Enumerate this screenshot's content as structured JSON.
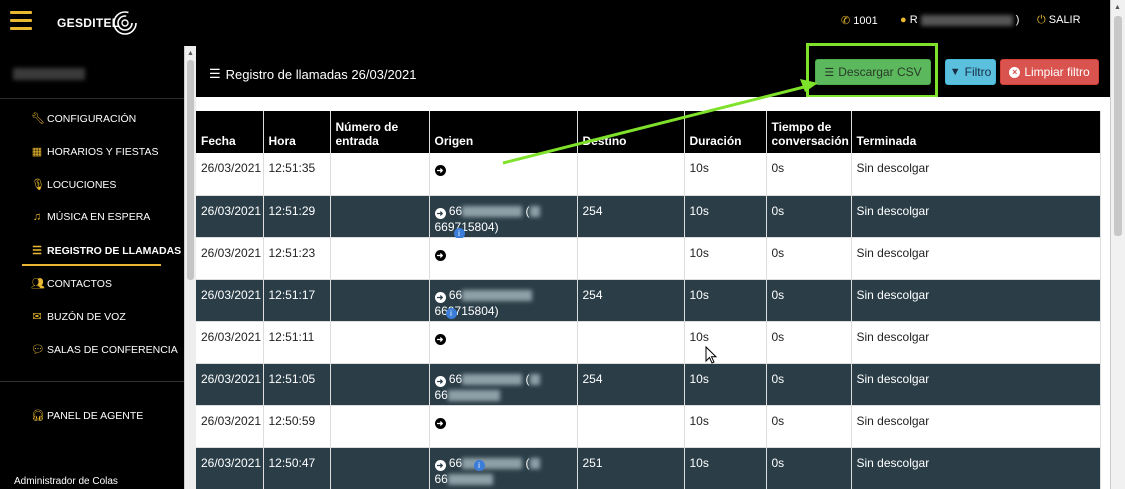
{
  "topbar": {
    "brand": "GESDITEL",
    "extension": "1001",
    "user_visible": "R",
    "user_suffix": ")",
    "logout": "SALIR"
  },
  "sidebar": {
    "items": [
      {
        "label": "CONFIGURACIÓN",
        "icon": "wrench-icon"
      },
      {
        "label": "HORARIOS Y FIESTAS",
        "icon": "calendar-icon"
      },
      {
        "label": "LOCUCIONES",
        "icon": "microphone-icon"
      },
      {
        "label": "MÚSICA EN ESPERA",
        "icon": "music-icon"
      },
      {
        "label": "REGISTRO DE LLAMADAS",
        "icon": "list-icon",
        "active": true
      },
      {
        "label": "CONTACTOS",
        "icon": "users-icon"
      },
      {
        "label": "BUZÓN DE VOZ",
        "icon": "envelope-icon"
      },
      {
        "label": "SALAS DE CONFERENCIA",
        "icon": "comments-icon"
      }
    ],
    "agent_panel": "PANEL DE AGENTE",
    "bottom": "Administrador de Colas"
  },
  "main": {
    "title": "Registro de llamadas 26/03/2021",
    "buttons": {
      "csv": "Descargar CSV",
      "filter": "Filtro",
      "clear": "Limpiar filtro"
    },
    "columns": [
      "Fecha",
      "Hora",
      "Número de entrada",
      "Origen",
      "Destino",
      "Duración",
      "Tiempo de conversación",
      "Terminada"
    ],
    "rows": [
      {
        "fecha": "26/03/2021",
        "hora": "12:51:35",
        "entrada": "",
        "origen": "",
        "destino": "",
        "duracion": "10s",
        "conversacion": "0s",
        "terminada": "Sin descolgar"
      },
      {
        "fecha": "26/03/2021",
        "hora": "12:51:29",
        "entrada": "",
        "origen": "66",
        "origen2": "669715804)",
        "destino": "254",
        "duracion": "10s",
        "conversacion": "0s",
        "terminada": "Sin descolgar"
      },
      {
        "fecha": "26/03/2021",
        "hora": "12:51:23",
        "entrada": "",
        "origen": "",
        "destino": "",
        "duracion": "10s",
        "conversacion": "0s",
        "terminada": "Sin descolgar"
      },
      {
        "fecha": "26/03/2021",
        "hora": "12:51:17",
        "entrada": "",
        "origen": "66",
        "origen2": "669715804)",
        "destino": "254",
        "duracion": "10s",
        "conversacion": "0s",
        "terminada": "Sin descolgar"
      },
      {
        "fecha": "26/03/2021",
        "hora": "12:51:11",
        "entrada": "",
        "origen": "",
        "destino": "",
        "duracion": "10s",
        "conversacion": "0s",
        "terminada": "Sin descolgar"
      },
      {
        "fecha": "26/03/2021",
        "hora": "12:51:05",
        "entrada": "",
        "origen": "66",
        "origen2": "66",
        "destino": "254",
        "duracion": "10s",
        "conversacion": "0s",
        "terminada": "Sin descolgar"
      },
      {
        "fecha": "26/03/2021",
        "hora": "12:50:59",
        "entrada": "",
        "origen": "",
        "destino": "",
        "duracion": "10s",
        "conversacion": "0s",
        "terminada": "Sin descolgar"
      },
      {
        "fecha": "26/03/2021",
        "hora": "12:50:47",
        "entrada": "",
        "origen": "66",
        "origen2": "66",
        "destino": "251",
        "duracion": "10s",
        "conversacion": "0s",
        "terminada": "Sin descolgar"
      }
    ]
  },
  "colors": {
    "accent": "#e9b830",
    "row_dark": "#2b3e48",
    "highlight": "#7fe22a"
  }
}
